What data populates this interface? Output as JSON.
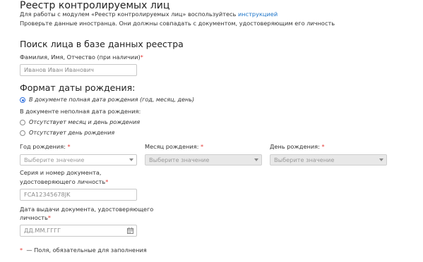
{
  "header": {
    "title": "Реестр контролируемых лиц",
    "intro_text": "Для работы с модулем «Реестр контролируемых лиц» воспользуйтесь",
    "intro_link": "инструкцией",
    "check_text": "Проверьте данные иностранца. Они должны совпадать с документом, удостоверяющим его личность"
  },
  "search": {
    "heading": "Поиск лица в базе данных реестра",
    "fio_label": "Фамилия, Имя, Отчество (при наличии)",
    "fio_required": "*",
    "fio_value": "Иванов Иван Иванович"
  },
  "birth_format": {
    "heading": "Формат даты рождения:",
    "options": [
      {
        "label": "В документе полная дата рождения (год, месяц, день)",
        "checked": true
      },
      {
        "label": "Отсутствует месяц и день рождения",
        "checked": false
      },
      {
        "label": "Отсутствует день рождения",
        "checked": false
      }
    ],
    "partial_label": "В документе неполная дата рождения:"
  },
  "birth_date": {
    "year_label": "Год рождения:",
    "month_label": "Месяц рождения:",
    "day_label": "День рождения:",
    "required": "*",
    "placeholder": "Выберите значение"
  },
  "document": {
    "number_label_line1": "Серия и номер документа,",
    "number_label_line2": "удостоверяющего личность",
    "number_value": "FCA12345678JK",
    "issue_label_line1": "Дата выдачи документа, удостоверяющего",
    "issue_label_line2": "личность",
    "issue_placeholder": "ДД.ММ.ГГГГ",
    "required": "*"
  },
  "footer": {
    "required_mark": "*",
    "note": "— Поля, обязательные для заполнения"
  },
  "colors": {
    "accent": "#2f6fde",
    "link": "#1a73c9",
    "required": "#e53935"
  }
}
